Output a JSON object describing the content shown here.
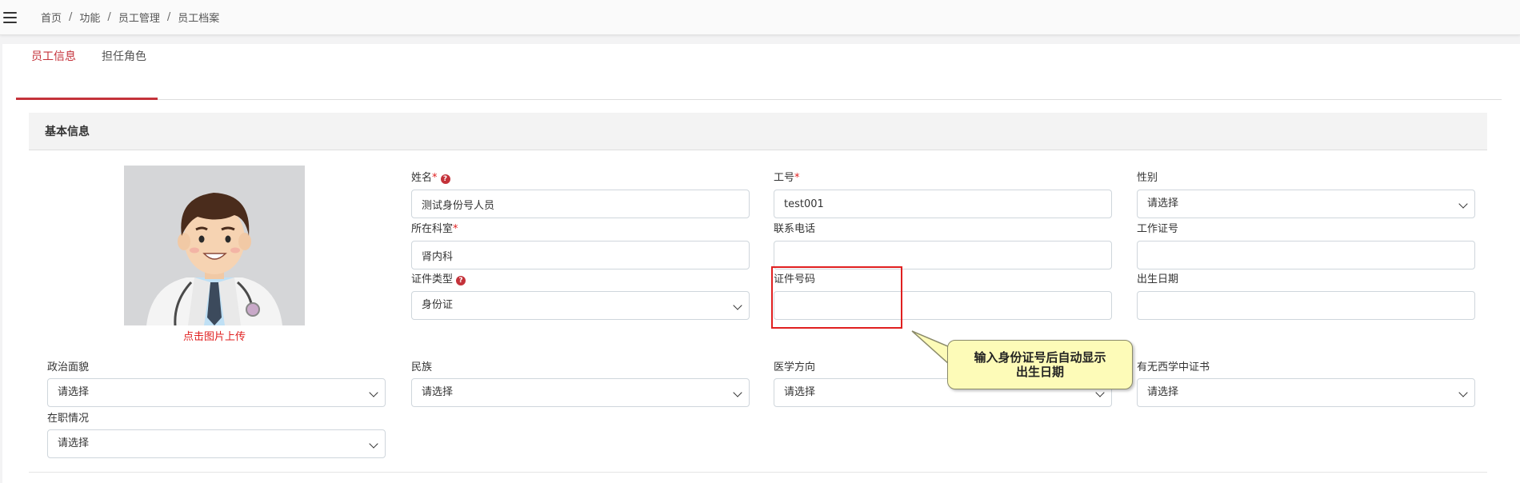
{
  "breadcrumb": {
    "items": [
      "首页",
      "功能",
      "员工管理",
      "员工档案"
    ],
    "separator": "/"
  },
  "tabs": [
    {
      "label": "员工信息",
      "active": true
    },
    {
      "label": "担任角色",
      "active": false
    }
  ],
  "section": {
    "title": "基本信息"
  },
  "photo": {
    "upload_hint": "点击图片上传"
  },
  "form": {
    "name": {
      "label": "姓名",
      "required_mark": "*",
      "value": "测试身份号人员"
    },
    "employee_no": {
      "label": "工号",
      "required_mark": "*",
      "value": "test001"
    },
    "gender": {
      "label": "性别",
      "value": "请选择"
    },
    "department": {
      "label": "所在科室",
      "required_mark": "*",
      "value": "肾内科"
    },
    "phone": {
      "label": "联系电话",
      "value": ""
    },
    "work_cert_no": {
      "label": "工作证号",
      "value": ""
    },
    "id_type": {
      "label": "证件类型",
      "value": "身份证"
    },
    "id_number": {
      "label": "证件号码",
      "value": ""
    },
    "birth_date": {
      "label": "出生日期",
      "value": ""
    },
    "political_status": {
      "label": "政治面貌",
      "value": "请选择"
    },
    "ethnicity": {
      "label": "民族",
      "value": "请选择"
    },
    "medical_direction": {
      "label": "医学方向",
      "value": "请选择"
    },
    "western_chinese_cert": {
      "label": "有无西学中证书",
      "value": "请选择"
    },
    "employment_status": {
      "label": "在职情况",
      "value": "请选择"
    }
  },
  "callout": {
    "line1": "输入身份证号后自动显示",
    "line2": "出生日期"
  },
  "colors": {
    "accent": "#c4323a",
    "required": "#e02020",
    "callout_bg": "#fdfbb8",
    "highlight_border": "#e02020"
  }
}
